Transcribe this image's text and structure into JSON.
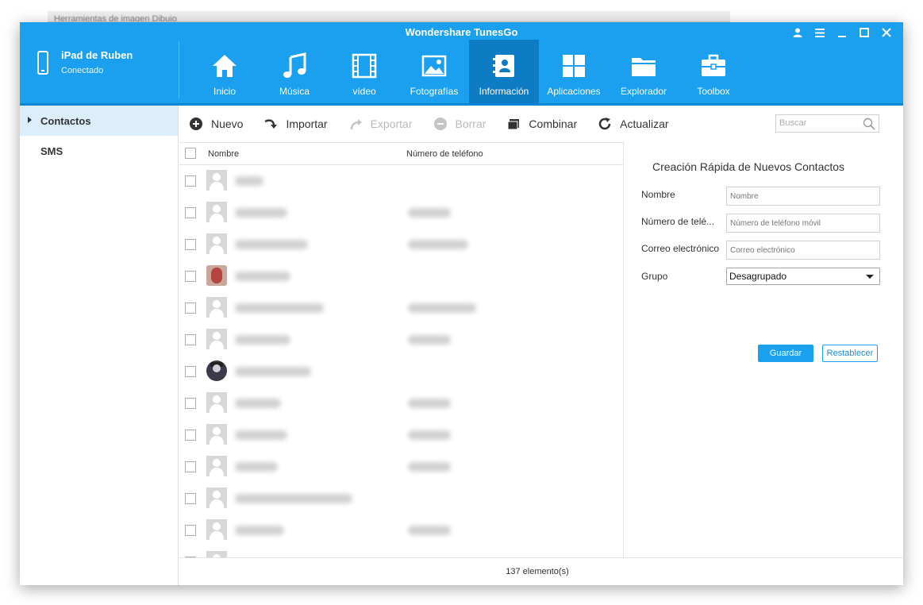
{
  "background_window": {
    "title": "Herramientas de imagen   Dibujo"
  },
  "app": {
    "title": "Wondershare TunesGo"
  },
  "window_controls": [
    {
      "name": "user-icon"
    },
    {
      "name": "menu-icon"
    },
    {
      "name": "minimize-icon"
    },
    {
      "name": "maximize-icon"
    },
    {
      "name": "close-icon"
    }
  ],
  "device": {
    "name": "iPad de Ruben",
    "status": "Conectado"
  },
  "nav": {
    "active": "Información",
    "items": [
      {
        "label": "Inicio",
        "icon": "home-icon"
      },
      {
        "label": "Música",
        "icon": "music-icon"
      },
      {
        "label": "vídeo",
        "icon": "video-icon"
      },
      {
        "label": "Fotografías",
        "icon": "photo-icon"
      },
      {
        "label": "Información",
        "icon": "contacts-book-icon"
      },
      {
        "label": "Aplicaciones",
        "icon": "apps-icon"
      },
      {
        "label": "Explorador",
        "icon": "folder-icon"
      },
      {
        "label": "Toolbox",
        "icon": "toolbox-icon"
      }
    ]
  },
  "sidebar": {
    "items": [
      {
        "label": "Contactos",
        "active": true
      },
      {
        "label": "SMS",
        "active": false
      }
    ]
  },
  "toolbar": {
    "new_label": "Nuevo",
    "import_label": "Importar",
    "export_label": "Exportar",
    "delete_label": "Borrar",
    "merge_label": "Combinar",
    "refresh_label": "Actualizar",
    "search_placeholder": "Buscar"
  },
  "list": {
    "columns": {
      "name": "Nombre",
      "phone": "Número de teléfono"
    },
    "rows_note_blurred": true
  },
  "form": {
    "title": "Creación Rápida de Nuevos Contactos",
    "name_label": "Nombre",
    "name_placeholder": "Nombre",
    "phone_label": "Número de telé...",
    "phone_placeholder": "Número de teléfono móvil",
    "email_label": "Correo electrónico",
    "email_placeholder": "Correo electrónico",
    "group_label": "Grupo",
    "group_value": "Desagrupado",
    "save_label": "Guardar",
    "reset_label": "Restablecer"
  },
  "status": {
    "count_text": "137 elemento(s)"
  },
  "colors": {
    "header": "#1aa0ef",
    "header_active": "#0e7cc4",
    "sidebar_active": "#dceefb"
  }
}
